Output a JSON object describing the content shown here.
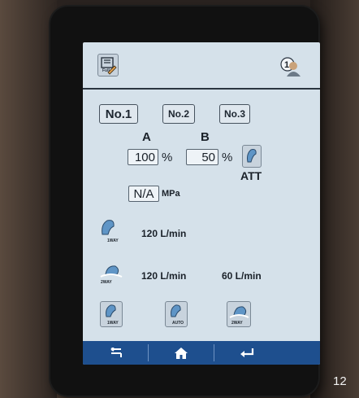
{
  "presets": [
    "No.1",
    "No.2",
    "No.3"
  ],
  "ratio": {
    "a_label": "A",
    "b_label": "B",
    "a_value": "100",
    "b_value": "50",
    "unit": "%"
  },
  "att_label": "ATT",
  "pressure": {
    "value": "N/A",
    "unit": "MPa"
  },
  "flow_1way": {
    "badge": "1WAY",
    "value": "120 L/min"
  },
  "flow_2way": {
    "badge": "2WAY",
    "value_a": "120 L/min",
    "value_b": "60 L/min"
  },
  "mode_buttons": [
    {
      "badge": "1WAY"
    },
    {
      "badge": "AUTO"
    },
    {
      "badge": "2WAY"
    }
  ],
  "top": {
    "profile_badge": "1",
    "tool_badge": "Full"
  },
  "page_number": "12"
}
